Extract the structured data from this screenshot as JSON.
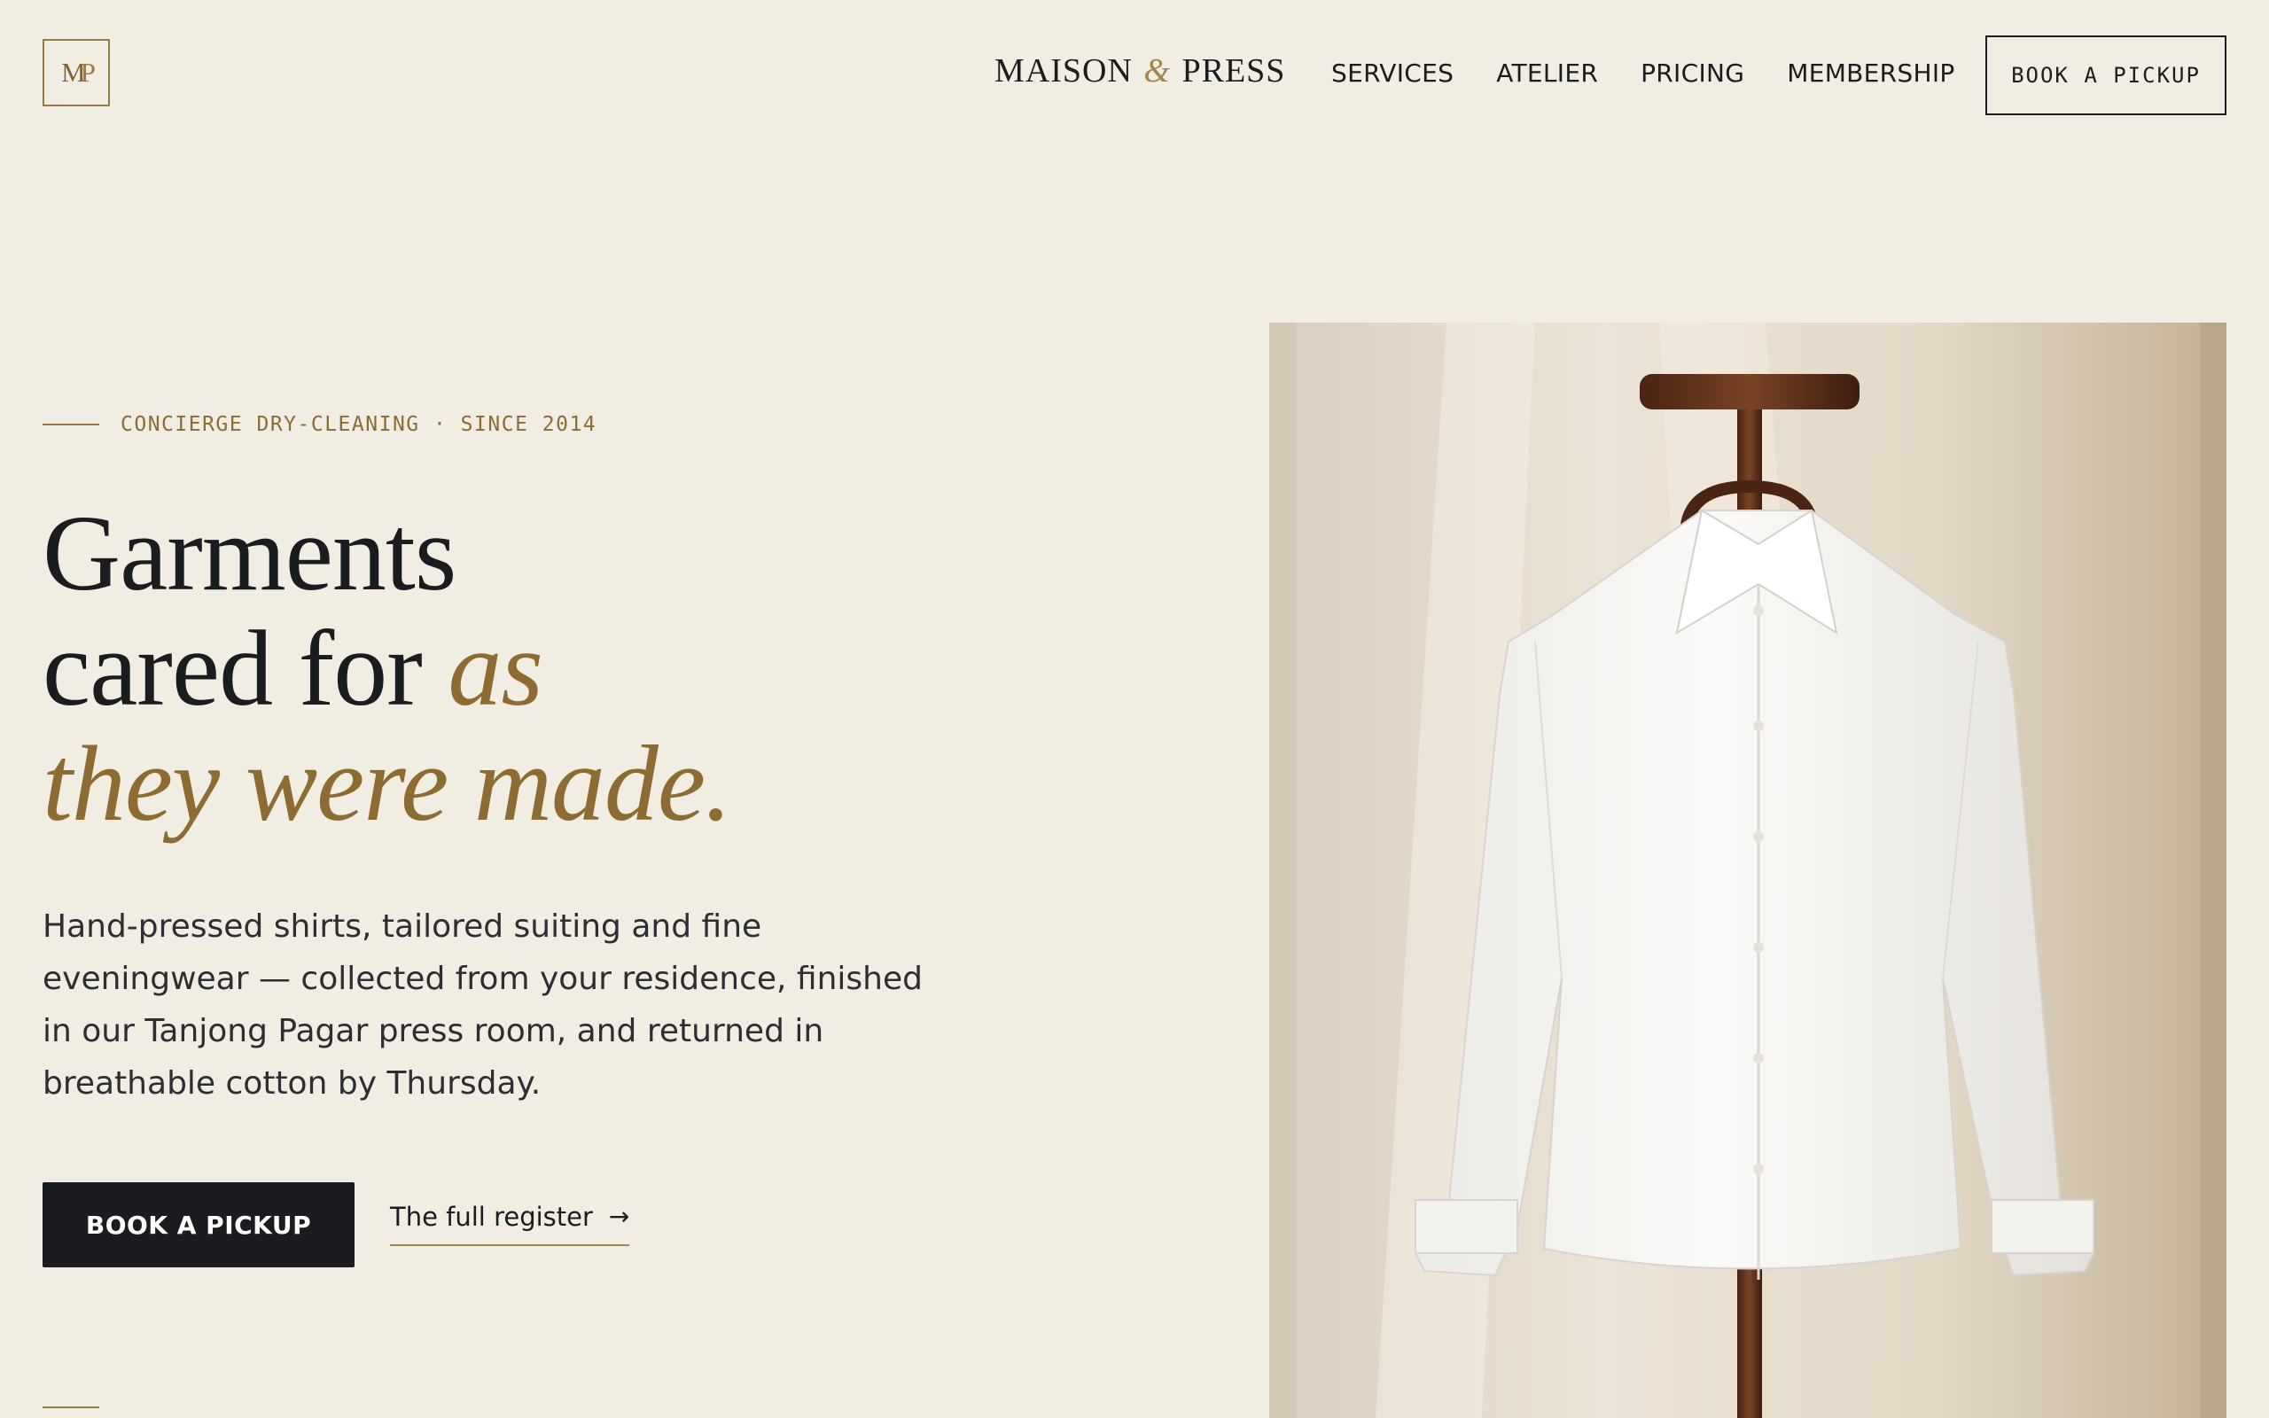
{
  "header": {
    "logo_monogram": [
      "M",
      "P"
    ],
    "brand_parts": [
      "MAISON",
      "&",
      "PRESS"
    ],
    "nav": [
      "SERVICES",
      "ATELIER",
      "PRICING",
      "MEMBERSHIP"
    ],
    "cta_label": "BOOK A PICKUP"
  },
  "hero": {
    "eyebrow": "CONCIERGE DRY-CLEANING · SINCE 2014",
    "headline": {
      "line1": "Garments",
      "line2": "cared for",
      "line2_accent": "as",
      "line3": "they were made."
    },
    "lede": "Hand-pressed shirts, tailored suiting and fine eveningwear — collected from your residence, finished in our Tanjong Pagar press room, and returned in breathable cotton by Thursday.",
    "primary_cta": "BOOK A PICKUP",
    "secondary_cta": "The full register",
    "secondary_cta_icon": "→",
    "image": {
      "subject": "white dress shirt on wooden valet stand",
      "icon": "shirt-on-valet-photo"
    }
  },
  "colors": {
    "background": "#f1ede2",
    "ink": "#1b1c20",
    "accent_gold": "#8d6c34"
  }
}
